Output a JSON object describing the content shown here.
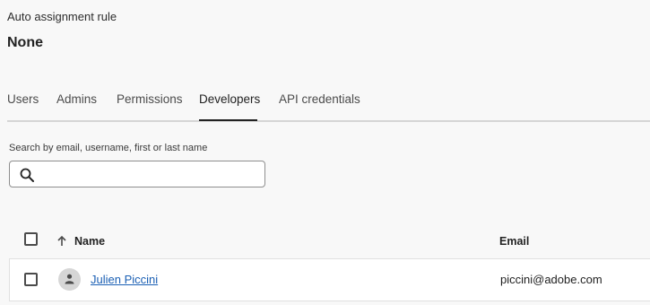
{
  "rule": {
    "label": "Auto assignment rule",
    "value": "None"
  },
  "tabs": [
    {
      "label": "Users",
      "active": false
    },
    {
      "label": "Admins",
      "active": false
    },
    {
      "label": "Permissions",
      "active": false
    },
    {
      "label": "Developers",
      "active": true
    },
    {
      "label": "API credentials",
      "active": false
    }
  ],
  "search": {
    "label": "Search by email, username, first or last name",
    "value": "",
    "icon": "search-icon"
  },
  "table": {
    "columns": {
      "name": "Name",
      "email": "Email",
      "sort_icon": "arrow-up-icon"
    },
    "rows": [
      {
        "name": "Julien Piccini",
        "email": "piccini@adobe.com",
        "avatar_icon": "user-icon"
      }
    ]
  },
  "colors": {
    "background": "#f8f8f8",
    "link": "#1a5fb4",
    "active_tab_underline": "#222222",
    "divider": "#d5d5d5"
  }
}
